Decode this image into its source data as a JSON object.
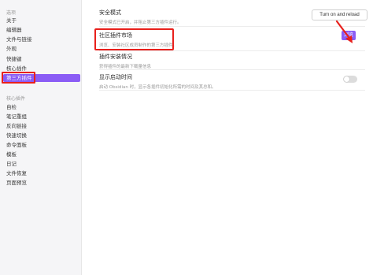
{
  "sidebar": {
    "options_heading": "选项",
    "options": [
      {
        "label": "关于"
      },
      {
        "label": "编辑器"
      },
      {
        "label": "文件与链接"
      },
      {
        "label": "外观"
      },
      {
        "label": "快捷键"
      },
      {
        "label": "核心插件"
      },
      {
        "label": "第三方插件",
        "active": true
      }
    ],
    "core_heading": "核心插件",
    "core_plugins": [
      {
        "label": "自检"
      },
      {
        "label": "笔记重组"
      },
      {
        "label": "反向链接"
      },
      {
        "label": "快速切换"
      },
      {
        "label": "命令面板"
      },
      {
        "label": "模板"
      },
      {
        "label": "日记"
      },
      {
        "label": "文件恢复"
      },
      {
        "label": "页面预览"
      }
    ]
  },
  "settings": {
    "safe_mode": {
      "title": "安全模式",
      "desc": "安全模式已开启，并阻止第三方插件运行。",
      "button": "Turn on and reload"
    },
    "community_market": {
      "title": "社区插件市场",
      "desc": "浏览、安装社区成员制作的第三方插件。",
      "button": "浏览"
    },
    "install_status": {
      "title": "插件安装情况",
      "desc": "获得插件的最新下载量信息"
    },
    "show_startup_time": {
      "title": "显示启动时间",
      "desc": "启动 Obsidian 时，显示各插件初始化所需的时间及其总和。",
      "enabled": false
    }
  },
  "colors": {
    "accent": "#8a5cf5",
    "annotation": "#e8201c"
  }
}
